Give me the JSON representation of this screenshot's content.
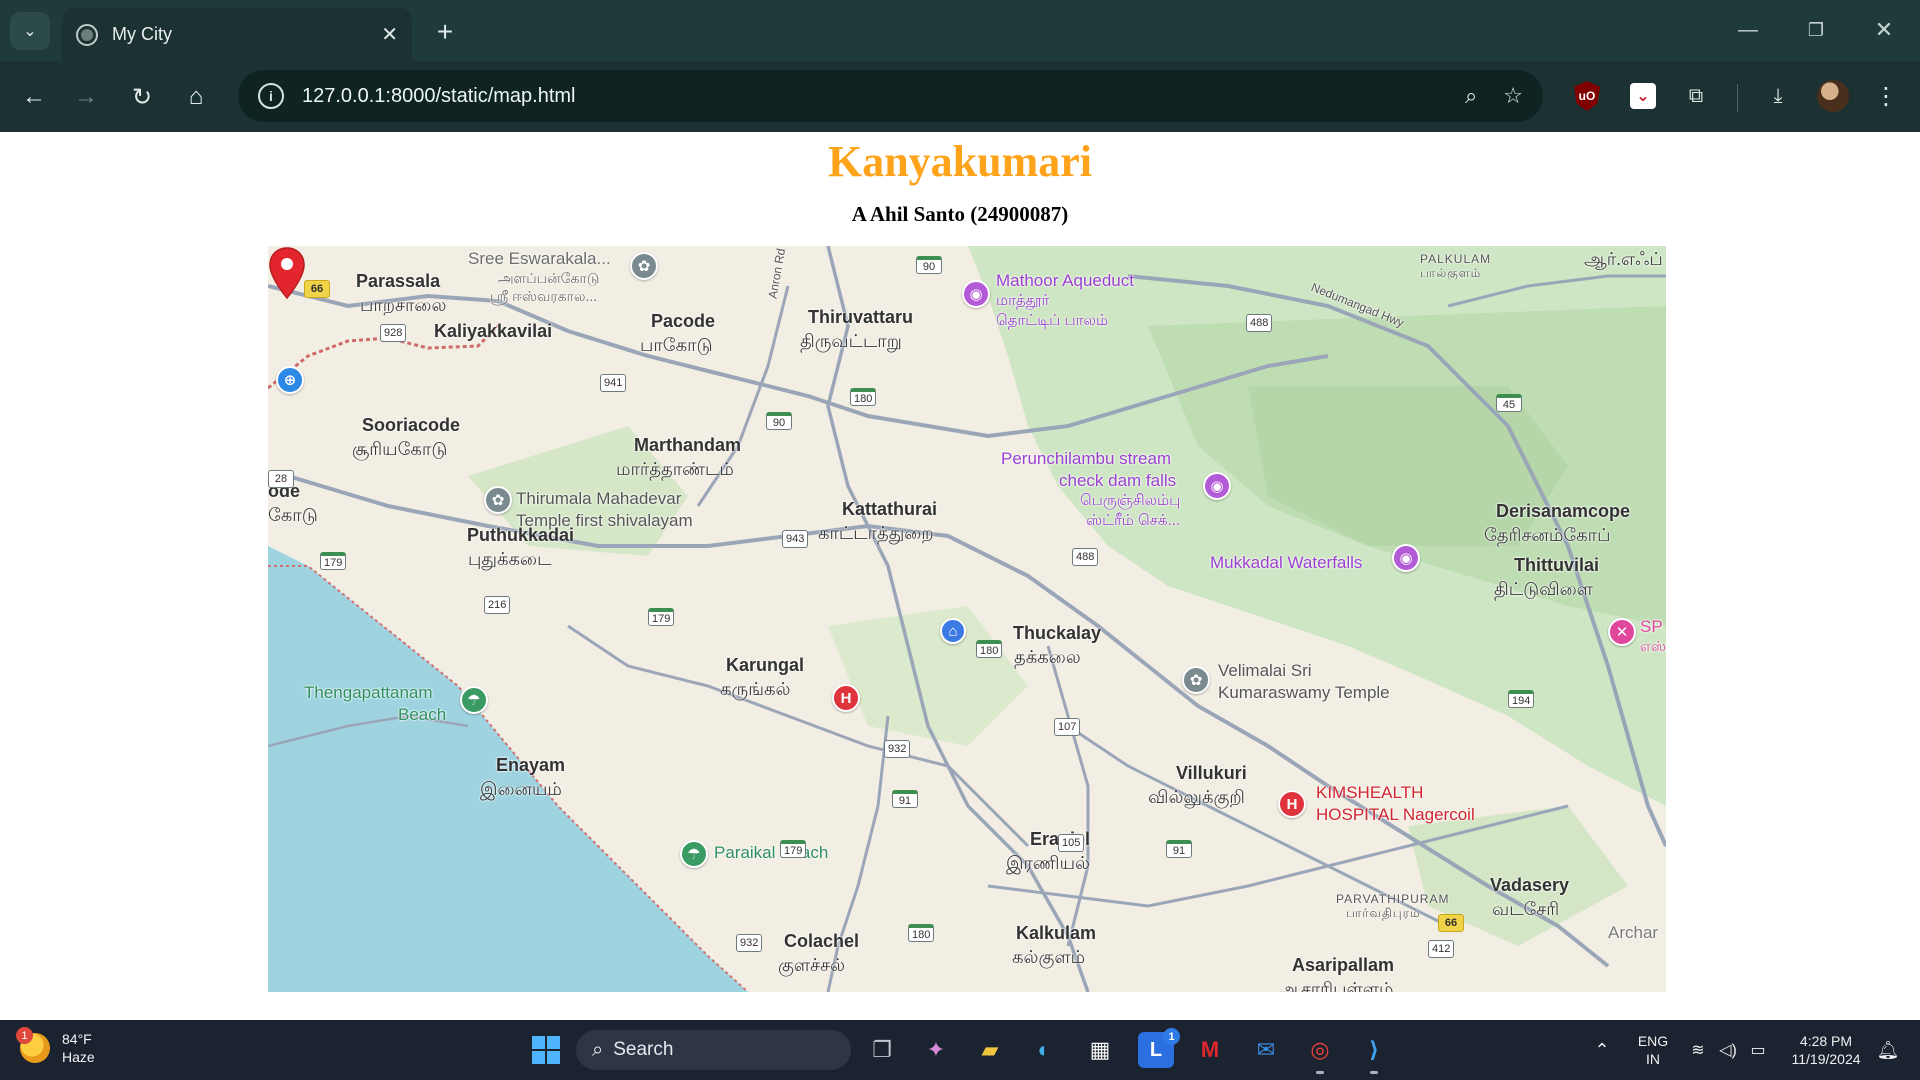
{
  "browser": {
    "tab_title": "My City",
    "url": "127.0.0.1:8000/static/map.html"
  },
  "page": {
    "title": "Kanyakumari",
    "subtitle": "A Ahil Santo (24900087)"
  },
  "map": {
    "places": {
      "parassala": "Parassala",
      "parassala_ta": "பாறசாலை",
      "kaliyakkavilai": "Kaliyakkavilai",
      "pacode": "Pacode",
      "pacode_ta": "பாகோடு",
      "thiruvattaru": "Thiruvattaru",
      "thiruvattaru_ta": "திருவட்டாறு",
      "sooriacode": "Sooriacode",
      "sooriacode_ta": "சூரியகோடு",
      "marthandam": "Marthandam",
      "marthandam_ta": "மார்த்தாண்டம்",
      "kattathurai": "Kattathurai",
      "kattathurai_ta": "காட்டாத்துறை",
      "puthukkadai": "Puthukkadai",
      "puthukkadai_ta": "புதுக்கடை",
      "ode": "ode",
      "ode_ta": "கோடு",
      "karungal": "Karungal",
      "karungal_ta": "கருங்கல்",
      "thuckalay": "Thuckalay",
      "thuckalay_ta": "தக்கலை",
      "enayam": "Enayam",
      "enayam_ta": "இனையம்",
      "villukuri": "Villukuri",
      "villukuri_ta": "வில்லுக்குறி",
      "eraniel": "Eraniel",
      "eraniel_ta": "இரணியல்",
      "colachel": "Colachel",
      "colachel_ta": "குளச்சல்",
      "kalkulam": "Kalkulam",
      "kalkulam_ta": "கல்குளம்",
      "asaripallam": "Asaripallam",
      "asaripallam_ta": "ஆசாரிபள்ளம்",
      "vadasery": "Vadasery",
      "vadasery_ta": "வடசேரி",
      "derisanamcope": "Derisanamcope",
      "derisanamcope_ta": "தேரிசனம்கோப்",
      "thittuvilai": "Thittuvilai",
      "thittuvilai_ta": "திட்டுவிளை",
      "palkulam": "PALKULAM",
      "palkulam_ta": "பால்குளம்",
      "arch": "Archar",
      "aar": "ஆர்.எஃப்",
      "parvathipuram": "PARVATHIPURAM",
      "parvathipuram_ta": "பார்வதிபுரம்",
      "nedumangad_hwy": "Nedumangad Hwy",
      "anron_rd": "Anron Rd"
    },
    "pois": {
      "sree_eswara": "Sree Eswarakala...",
      "sree_eswara_ta1": "அளப்பன்கோடு",
      "sree_eswara_ta2": "ஸ்ரீ ஈஸ்வரகால...",
      "mathoor": "Mathoor Aqueduct",
      "mathoor_ta1": "மாத்தூர்",
      "mathoor_ta2": "தொட்டிப் பாலம்",
      "perunchilambu": "Perunchilambu stream",
      "perunchilambu2": "check dam falls",
      "perunchilambu_ta1": "பெருஞ்சிலம்பு",
      "perunchilambu_ta2": "ஸ்ட்ரீம் செக்...",
      "thirumala": "Thirumala Mahadevar",
      "thirumala2": "Temple first shivalayam",
      "mukkadal": "Mukkadal Waterfalls",
      "thengapattanam": "Thengapattanam",
      "thengapattanam2": "Beach",
      "velimalai": "Velimalai Sri",
      "velimalai2": "Kumaraswamy Temple",
      "kimshealth": "KIMSHEALTH",
      "kimshealth2": "HOSPITAL Nagercoil",
      "paraikal": "Paraikal Beach",
      "sp": "SP",
      "sp_ta": "எஸ்"
    },
    "roads": {
      "r66a": "66",
      "r928": "928",
      "r941": "941",
      "r90a": "90",
      "r90b": "90",
      "r180a": "180",
      "r180b": "180",
      "r180c": "180",
      "r488a": "488",
      "r488b": "488",
      "r45": "45",
      "r28": "28",
      "r943": "943",
      "r179a": "179",
      "r179b": "179",
      "r179c": "179",
      "r216": "216",
      "r932a": "932",
      "r932b": "932",
      "r91a": "91",
      "r91b": "91",
      "r107": "107",
      "r105": "105",
      "r194": "194",
      "r66b": "66",
      "r412": "412"
    }
  },
  "taskbar": {
    "weather_temp": "84°F",
    "weather_desc": "Haze",
    "weather_badge": "1",
    "search_label": "Search",
    "lang_1": "ENG",
    "lang_2": "IN",
    "time": "4:28 PM",
    "date": "11/19/2024",
    "todo_badge": "1"
  }
}
